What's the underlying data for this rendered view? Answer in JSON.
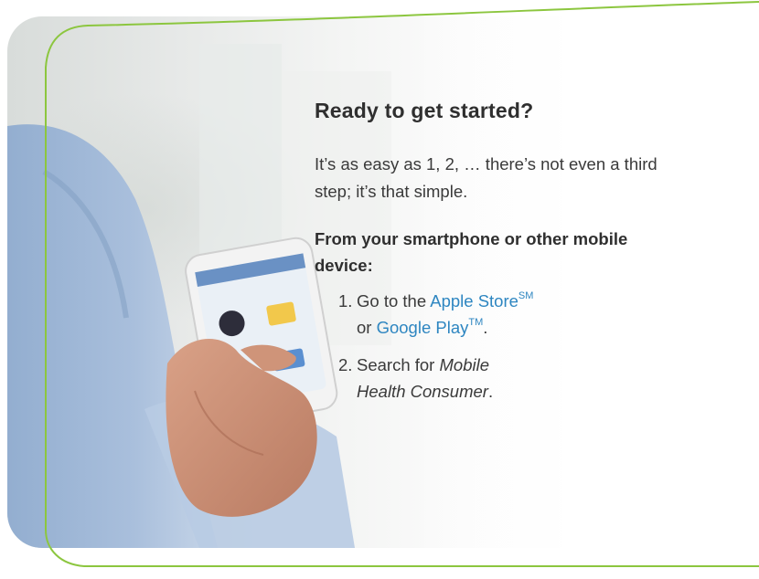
{
  "colors": {
    "frame_line": "#8cc63f",
    "link": "#2e86c1",
    "text": "#3a3a3a"
  },
  "headline": "Ready to get started?",
  "intro": "It’s as easy as 1, 2, … there’s not even a third step; it’s that simple.",
  "subhead": "From your smartphone or other mobile device:",
  "steps": [
    {
      "number": "1.",
      "prefix": "Go to the",
      "link1": "Apple Store",
      "link1_mark": "SM",
      "joiner": "or",
      "link2": "Google Play",
      "link2_mark": "TM",
      "suffix": "."
    },
    {
      "number": "2.",
      "prefix": "Search for",
      "app_name_line1": "Mobile",
      "app_name_line2": "Health Consumer",
      "suffix": "."
    }
  ],
  "image": {
    "subject": "person holding smartphone",
    "icon": "smartphone-in-hand-photo"
  }
}
